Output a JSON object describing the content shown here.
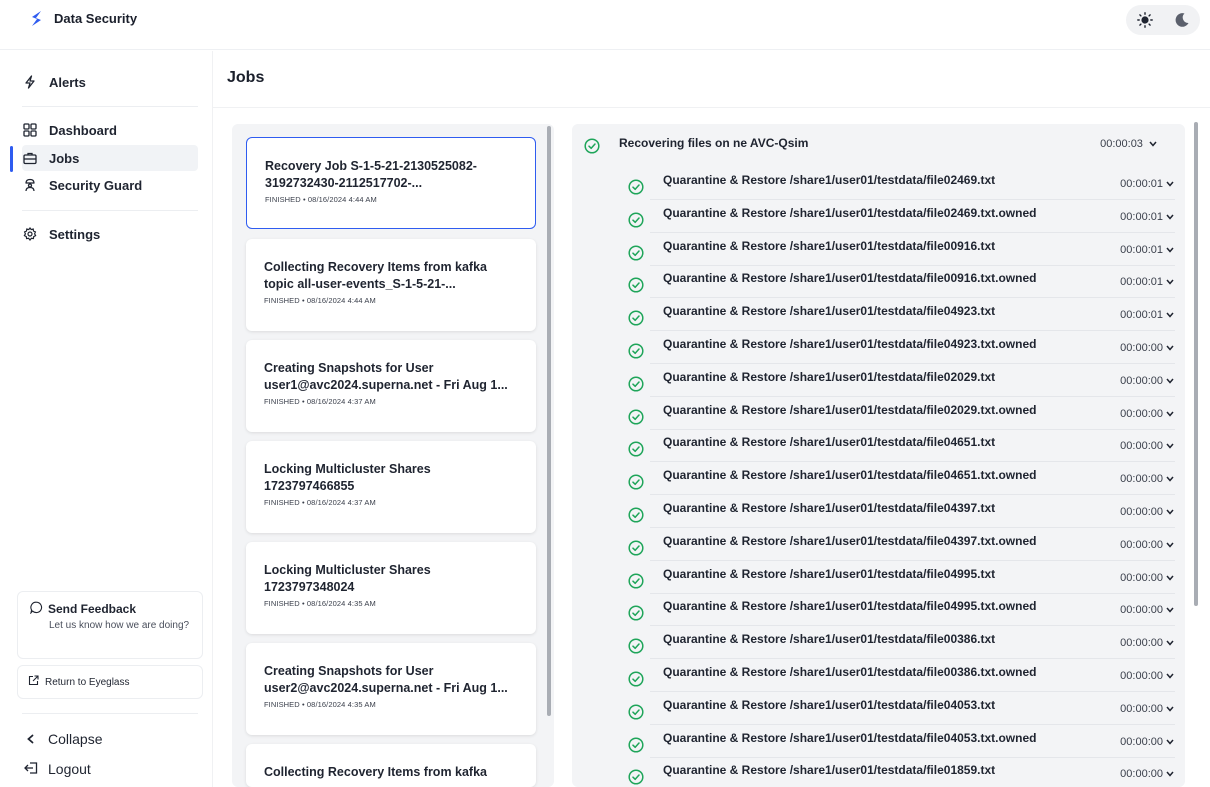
{
  "app": {
    "title": "Data Security",
    "brand_color": "#2f5cf0",
    "success_color": "#1fa55a"
  },
  "sidebar": {
    "items": [
      {
        "label": "Alerts",
        "icon": "lightning-icon"
      },
      {
        "label": "Dashboard",
        "icon": "grid-icon"
      },
      {
        "label": "Jobs",
        "icon": "briefcase-icon",
        "active": true
      },
      {
        "label": "Security Guard",
        "icon": "guard-icon"
      },
      {
        "label": "Settings",
        "icon": "gear-icon"
      }
    ],
    "feedback": {
      "title": "Send Feedback",
      "subtitle": "Let us know how we are doing?"
    },
    "return_label": "Return to Eyeglass",
    "collapse_label": "Collapse",
    "logout_label": "Logout"
  },
  "page": {
    "title": "Jobs"
  },
  "jobs": [
    {
      "title": "Recovery Job S-1-5-21-2130525082-3192732430-2112517702-...",
      "status": "FINISHED • 08/16/2024 4:44 AM",
      "selected": true
    },
    {
      "title": "Collecting Recovery Items from kafka topic all-user-events_S-1-5-21-...",
      "status": "FINISHED • 08/16/2024 4:44 AM"
    },
    {
      "title": "Creating Snapshots for User user1@avc2024.superna.net - Fri Aug 1...",
      "status": "FINISHED • 08/16/2024 4:37 AM"
    },
    {
      "title": "Locking Multicluster Shares 1723797466855",
      "status": "FINISHED • 08/16/2024 4:37 AM"
    },
    {
      "title": "Locking Multicluster Shares 1723797348024",
      "status": "FINISHED • 08/16/2024 4:35 AM"
    },
    {
      "title": "Creating Snapshots for User user2@avc2024.superna.net - Fri Aug 1...",
      "status": "FINISHED • 08/16/2024 4:35 AM"
    },
    {
      "title": "Collecting Recovery Items from kafka",
      "status": ""
    }
  ],
  "detail": {
    "parent": {
      "label": "Recovering files on ne AVC-Qsim",
      "time": "00:00:03"
    },
    "children": [
      {
        "label": "Quarantine & Restore /share1/user01/testdata/file02469.txt",
        "time": "00:00:01"
      },
      {
        "label": "Quarantine & Restore /share1/user01/testdata/file02469.txt.owned",
        "time": "00:00:01"
      },
      {
        "label": "Quarantine & Restore /share1/user01/testdata/file00916.txt",
        "time": "00:00:01"
      },
      {
        "label": "Quarantine & Restore /share1/user01/testdata/file00916.txt.owned",
        "time": "00:00:01"
      },
      {
        "label": "Quarantine & Restore /share1/user01/testdata/file04923.txt",
        "time": "00:00:01"
      },
      {
        "label": "Quarantine & Restore /share1/user01/testdata/file04923.txt.owned",
        "time": "00:00:00"
      },
      {
        "label": "Quarantine & Restore /share1/user01/testdata/file02029.txt",
        "time": "00:00:00"
      },
      {
        "label": "Quarantine & Restore /share1/user01/testdata/file02029.txt.owned",
        "time": "00:00:00"
      },
      {
        "label": "Quarantine & Restore /share1/user01/testdata/file04651.txt",
        "time": "00:00:00"
      },
      {
        "label": "Quarantine & Restore /share1/user01/testdata/file04651.txt.owned",
        "time": "00:00:00"
      },
      {
        "label": "Quarantine & Restore /share1/user01/testdata/file04397.txt",
        "time": "00:00:00"
      },
      {
        "label": "Quarantine & Restore /share1/user01/testdata/file04397.txt.owned",
        "time": "00:00:00"
      },
      {
        "label": "Quarantine & Restore /share1/user01/testdata/file04995.txt",
        "time": "00:00:00"
      },
      {
        "label": "Quarantine & Restore /share1/user01/testdata/file04995.txt.owned",
        "time": "00:00:00"
      },
      {
        "label": "Quarantine & Restore /share1/user01/testdata/file00386.txt",
        "time": "00:00:00"
      },
      {
        "label": "Quarantine & Restore /share1/user01/testdata/file00386.txt.owned",
        "time": "00:00:00"
      },
      {
        "label": "Quarantine & Restore /share1/user01/testdata/file04053.txt",
        "time": "00:00:00"
      },
      {
        "label": "Quarantine & Restore /share1/user01/testdata/file04053.txt.owned",
        "time": "00:00:00"
      },
      {
        "label": "Quarantine & Restore /share1/user01/testdata/file01859.txt",
        "time": "00:00:00"
      }
    ]
  }
}
